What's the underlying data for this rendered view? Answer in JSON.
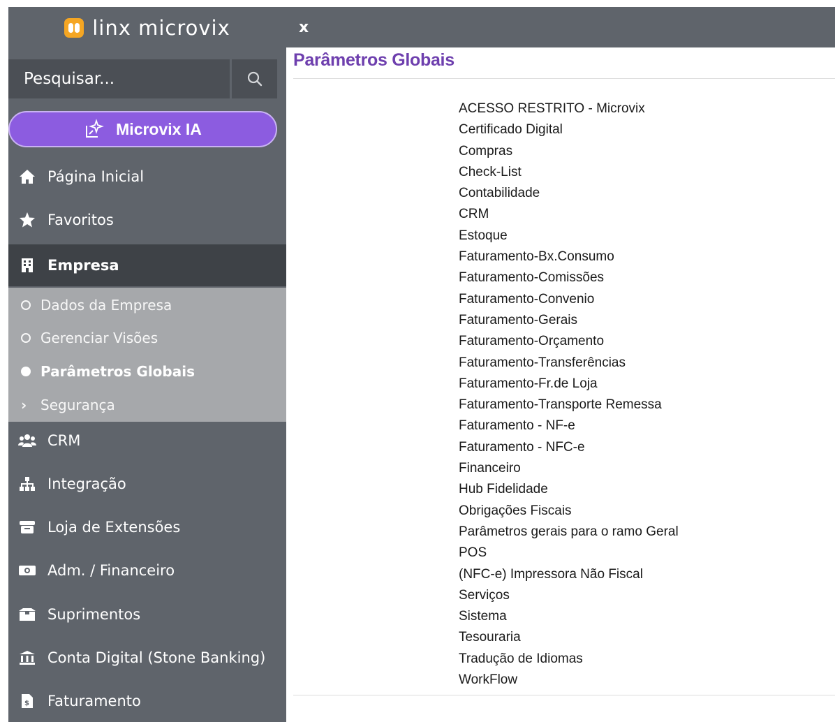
{
  "brand": {
    "name": "linx microvix"
  },
  "search": {
    "placeholder": "Pesquisar..."
  },
  "ai_button": {
    "label": "Microvix IA"
  },
  "nav": {
    "home": "Página Inicial",
    "favorites": "Favoritos",
    "company": "Empresa",
    "crm": "CRM",
    "integration": "Integração",
    "extensions": "Loja de Extensões",
    "admin_finance": "Adm. / Financeiro",
    "supplies": "Suprimentos",
    "digital_account": "Conta Digital (Stone Banking)",
    "billing": "Faturamento"
  },
  "company_submenu": {
    "company_data": "Dados da Empresa",
    "manage_views": "Gerenciar Visões",
    "global_params": "Parâmetros Globais",
    "security": "Segurança"
  },
  "topbar": {
    "close": "x"
  },
  "page": {
    "title": "Parâmetros Globais",
    "items": [
      "ACESSO RESTRITO - Microvix",
      "Certificado Digital",
      "Compras",
      "Check-List",
      "Contabilidade",
      "CRM",
      "Estoque",
      "Faturamento-Bx.Consumo",
      "Faturamento-Comissões",
      "Faturamento-Convenio",
      "Faturamento-Gerais",
      "Faturamento-Orçamento",
      "Faturamento-Transferências",
      "Faturamento-Fr.de Loja",
      "Faturamento-Transporte Remessa",
      "Faturamento - NF-e",
      "Faturamento - NFC-e",
      "Financeiro",
      "Hub Fidelidade",
      "Obrigações Fiscais",
      "Parâmetros gerais para o ramo Geral",
      "POS",
      "(NFC-e) Impressora Não Fiscal",
      "Serviços",
      "Sistema",
      "Tesouraria",
      "Tradução de Idiomas",
      "WorkFlow"
    ]
  },
  "colors": {
    "sidebar_bg": "#5f646b",
    "active_bg": "#3e4247",
    "submenu_bg": "#a6a8ab",
    "ai_purple": "#8c5ce0",
    "title_purple": "#6e3fae",
    "logo_orange": "#f5a623"
  }
}
